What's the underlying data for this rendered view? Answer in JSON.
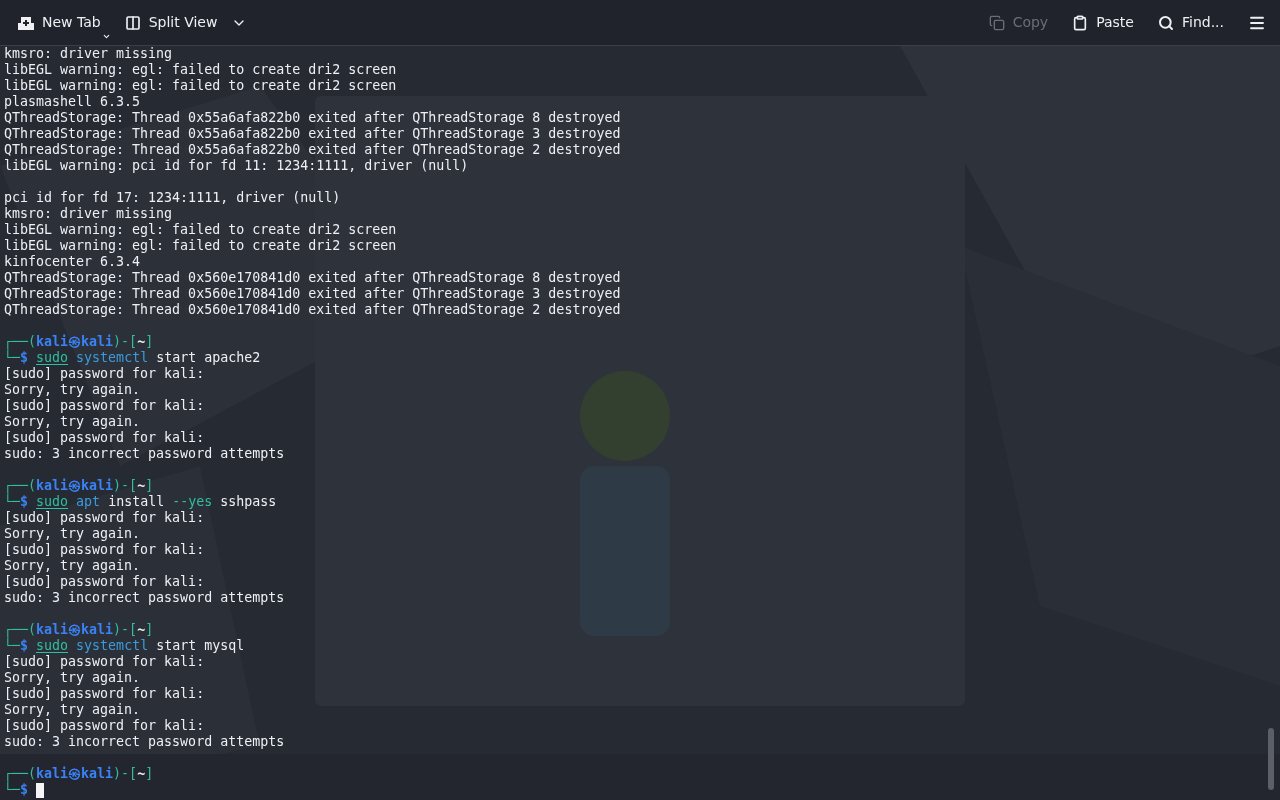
{
  "toolbar": {
    "left": [
      {
        "kind": "new_tab",
        "label": "New Tab",
        "disabled": false
      },
      {
        "kind": "split_view",
        "label": "Split View",
        "disabled": false
      }
    ],
    "right": [
      {
        "kind": "copy",
        "label": "Copy",
        "disabled": true
      },
      {
        "kind": "paste",
        "label": "Paste",
        "disabled": false
      },
      {
        "kind": "find",
        "label": "Find...",
        "disabled": false
      }
    ]
  },
  "terminal": {
    "lines": [
      {
        "kind": "plain",
        "text": "kmsro: driver missing"
      },
      {
        "kind": "plain",
        "text": "libEGL warning: egl: failed to create dri2 screen"
      },
      {
        "kind": "plain",
        "text": "libEGL warning: egl: failed to create dri2 screen"
      },
      {
        "kind": "plain",
        "text": "plasmashell 6.3.5"
      },
      {
        "kind": "plain",
        "text": "QThreadStorage: Thread 0x55a6afa822b0 exited after QThreadStorage 8 destroyed"
      },
      {
        "kind": "plain",
        "text": "QThreadStorage: Thread 0x55a6afa822b0 exited after QThreadStorage 3 destroyed"
      },
      {
        "kind": "plain",
        "text": "QThreadStorage: Thread 0x55a6afa822b0 exited after QThreadStorage 2 destroyed"
      },
      {
        "kind": "plain",
        "text": "libEGL warning: pci id for fd 11: 1234:1111, driver (null)"
      },
      {
        "kind": "blank"
      },
      {
        "kind": "plain",
        "text": "pci id for fd 17: 1234:1111, driver (null)"
      },
      {
        "kind": "plain",
        "text": "kmsro: driver missing"
      },
      {
        "kind": "plain",
        "text": "libEGL warning: egl: failed to create dri2 screen"
      },
      {
        "kind": "plain",
        "text": "libEGL warning: egl: failed to create dri2 screen"
      },
      {
        "kind": "plain",
        "text": "kinfocenter 6.3.4"
      },
      {
        "kind": "plain",
        "text": "QThreadStorage: Thread 0x560e170841d0 exited after QThreadStorage 8 destroyed"
      },
      {
        "kind": "plain",
        "text": "QThreadStorage: Thread 0x560e170841d0 exited after QThreadStorage 3 destroyed"
      },
      {
        "kind": "plain",
        "text": "QThreadStorage: Thread 0x560e170841d0 exited after QThreadStorage 2 destroyed"
      },
      {
        "kind": "blank"
      },
      {
        "kind": "prompt",
        "open": "┌──(",
        "user": "kali",
        "at": "㉿",
        "host": "kali",
        "mid": ")-[",
        "dir": "~",
        "close": "]"
      },
      {
        "kind": "command",
        "corner": "└─",
        "sign": "$",
        "tokens": [
          {
            "kind": "sudo",
            "text": "sudo"
          },
          {
            "kind": "program",
            "text": "systemctl"
          },
          {
            "kind": "arg",
            "text": "start apache2"
          }
        ]
      },
      {
        "kind": "plain",
        "text": "[sudo] password for kali:"
      },
      {
        "kind": "plain",
        "text": "Sorry, try again."
      },
      {
        "kind": "plain",
        "text": "[sudo] password for kali:"
      },
      {
        "kind": "plain",
        "text": "Sorry, try again."
      },
      {
        "kind": "plain",
        "text": "[sudo] password for kali:"
      },
      {
        "kind": "plain",
        "text": "sudo: 3 incorrect password attempts"
      },
      {
        "kind": "blank"
      },
      {
        "kind": "prompt",
        "open": "┌──(",
        "user": "kali",
        "at": "㉿",
        "host": "kali",
        "mid": ")-[",
        "dir": "~",
        "close": "]"
      },
      {
        "kind": "command",
        "corner": "└─",
        "sign": "$",
        "tokens": [
          {
            "kind": "sudo",
            "text": "sudo"
          },
          {
            "kind": "program",
            "text": "apt"
          },
          {
            "kind": "arg",
            "text": "install"
          },
          {
            "kind": "option",
            "text": "--yes"
          },
          {
            "kind": "arg",
            "text": "sshpass"
          }
        ]
      },
      {
        "kind": "plain",
        "text": "[sudo] password for kali:"
      },
      {
        "kind": "plain",
        "text": "Sorry, try again."
      },
      {
        "kind": "plain",
        "text": "[sudo] password for kali:"
      },
      {
        "kind": "plain",
        "text": "Sorry, try again."
      },
      {
        "kind": "plain",
        "text": "[sudo] password for kali:"
      },
      {
        "kind": "plain",
        "text": "sudo: 3 incorrect password attempts"
      },
      {
        "kind": "blank"
      },
      {
        "kind": "prompt",
        "open": "┌──(",
        "user": "kali",
        "at": "㉿",
        "host": "kali",
        "mid": ")-[",
        "dir": "~",
        "close": "]"
      },
      {
        "kind": "command",
        "corner": "└─",
        "sign": "$",
        "tokens": [
          {
            "kind": "sudo",
            "text": "sudo"
          },
          {
            "kind": "program",
            "text": "systemctl"
          },
          {
            "kind": "arg",
            "text": "start mysql"
          }
        ]
      },
      {
        "kind": "plain",
        "text": "[sudo] password for kali:"
      },
      {
        "kind": "plain",
        "text": "Sorry, try again."
      },
      {
        "kind": "plain",
        "text": "[sudo] password for kali:"
      },
      {
        "kind": "plain",
        "text": "Sorry, try again."
      },
      {
        "kind": "plain",
        "text": "[sudo] password for kali:"
      },
      {
        "kind": "plain",
        "text": "sudo: 3 incorrect password attempts"
      },
      {
        "kind": "blank"
      },
      {
        "kind": "prompt",
        "open": "┌──(",
        "user": "kali",
        "at": "㉿",
        "host": "kali",
        "mid": ")-[",
        "dir": "~",
        "close": "]"
      },
      {
        "kind": "input",
        "corner": "└─",
        "sign": "$"
      }
    ]
  }
}
